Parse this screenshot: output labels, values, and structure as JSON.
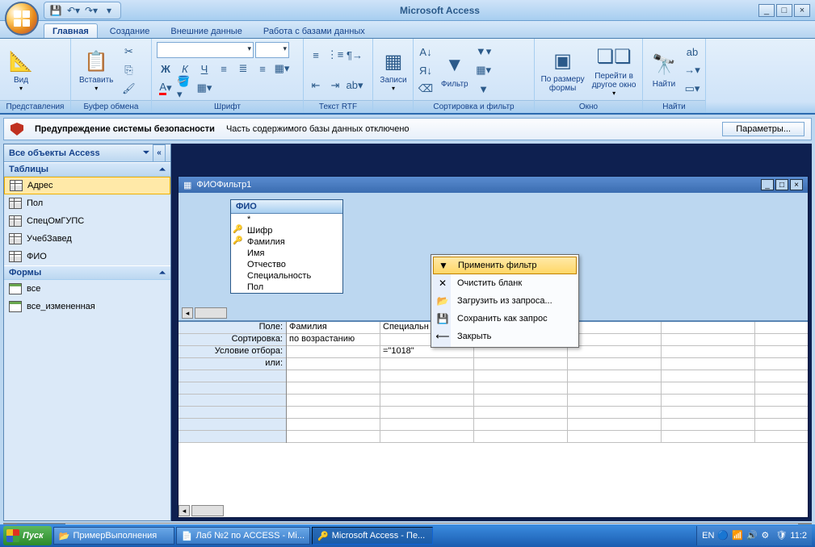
{
  "app_title": "Microsoft Access",
  "tabs": {
    "home": "Главная",
    "create": "Создание",
    "external": "Внешние данные",
    "dbtools": "Работа с базами данных"
  },
  "ribbon": {
    "view": "Вид",
    "view_grp": "Представления",
    "paste": "Вставить",
    "clip_grp": "Буфер обмена",
    "font_grp": "Шрифт",
    "rtf_grp": "Текст RTF",
    "records": "Записи",
    "filter": "Фильтр",
    "sortfilter_grp": "Сортировка и фильтр",
    "fit": "По размеру\nформы",
    "switch": "Перейти в\nдругое окно",
    "win_grp": "Окно",
    "find": "Найти",
    "find_grp": "Найти"
  },
  "security": {
    "title": "Предупреждение системы безопасности",
    "msg": "Часть содержимого базы данных отключено",
    "btn": "Параметры..."
  },
  "nav": {
    "header": "Все объекты Access",
    "tables_hdr": "Таблицы",
    "tables": [
      "Адрес",
      "Пол",
      "СпецОмГУПС",
      "УчебЗавед",
      "ФИО"
    ],
    "forms_hdr": "Формы",
    "forms": [
      "все",
      "все_измененная"
    ]
  },
  "docwin": {
    "title": "ФИОФильтр1"
  },
  "fieldlist": {
    "title": "ФИО",
    "star": "*",
    "fields": [
      "Шифр",
      "Фамилия",
      "Имя",
      "Отчество",
      "Специальность",
      "Пол"
    ]
  },
  "context": {
    "apply": "Применить фильтр",
    "clear": "Очистить бланк",
    "load": "Загрузить из запроса...",
    "save": "Сохранить как запрос",
    "close": "Закрыть"
  },
  "grid": {
    "labels": {
      "field": "Поле:",
      "sort": "Сортировка:",
      "criteria": "Условие отбора:",
      "or": "или:"
    },
    "col1_field": "Фамилия",
    "col1_sort": "по возрастанию",
    "col2_field": "Специальн",
    "col2_crit": "=\"1018\""
  },
  "taskbar": {
    "start": "Пуск",
    "t1": "ПримерВыполнения",
    "t2": "Лаб №2 по ACCESS - Mi...",
    "t3": "Microsoft Access - Пе...",
    "lang": "EN",
    "time": "11:2"
  }
}
